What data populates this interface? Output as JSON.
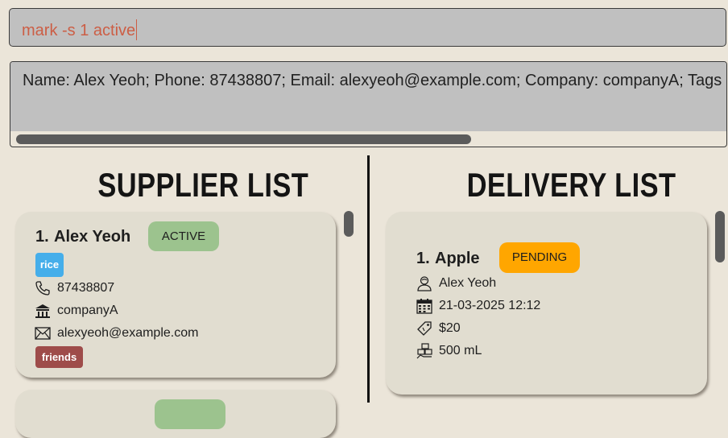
{
  "command": {
    "value": "mark -s 1 active"
  },
  "result": {
    "text": "Name: Alex Yeoh; Phone: 87438807; Email: alexyeoh@example.com; Company: companyA; Tags"
  },
  "suppliers": {
    "title": "SUPPLIER LIST",
    "items": [
      {
        "index": "1.",
        "name": "Alex Yeoh",
        "status": "ACTIVE",
        "tag1": "rice",
        "phone": "87438807",
        "company": "companyA",
        "email": "alexyeoh@example.com",
        "tag2": "friends"
      }
    ]
  },
  "deliveries": {
    "title": "DELIVERY LIST",
    "items": [
      {
        "index": "1.",
        "product": "Apple",
        "status": "PENDING",
        "supplier": "Alex Yeoh",
        "datetime": "21-03-2025 12:12",
        "cost": "$20",
        "quantity": "500 mL"
      }
    ]
  },
  "colors": {
    "active": "#9cc38e",
    "pending": "#ffa600",
    "tag_rice": "#45aeea",
    "tag_friends": "#9e4c4a",
    "command_text": "#cc5e45"
  },
  "icons": {
    "phone": "phone-icon",
    "company": "building-icon",
    "email": "envelope-icon",
    "supplier": "person-icon",
    "date": "calendar-icon",
    "cost": "price-tag-icon",
    "quantity": "boxes-icon"
  }
}
